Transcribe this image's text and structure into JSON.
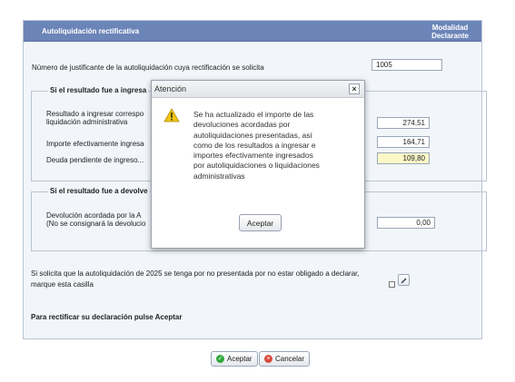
{
  "panel": {
    "title": "Autoliquidación rectificativa",
    "modality_line1": "Modalidad",
    "modality_line2": "Declarante"
  },
  "justificante": {
    "label": "Número de justificante de la autoliquidación cuya rectificación se solicita",
    "value": "1005"
  },
  "section_ingresar": {
    "legend": "Si el resultado fue a ingresa",
    "row1_label_line1": "Resultado a ingresar correspo",
    "row1_label_line2": "liquidación administrativa",
    "row1_value": "274,51",
    "row2_label": "Importe efectivamente ingresa",
    "row2_value": "164,71",
    "row3_label": "Deuda pendiente de ingreso...",
    "row3_value": "109,80"
  },
  "section_devolver": {
    "legend": "Si el resultado fue a devolve",
    "row1_label_line1": "Devolución acordada por la A",
    "row1_label_line2": "(No se consignará la devolucio",
    "row1_value": "0,00"
  },
  "no_presentada": {
    "line1": "Si solicita que la autoliquidación de 2025 se tenga por no presentada por no estar obligado a declarar,",
    "line2": "marque esta casilla"
  },
  "instruction": "Para rectificar su declaración pulse Aceptar",
  "buttons": {
    "accept": "Aceptar",
    "cancel": "Cancelar"
  },
  "dialog": {
    "title": "Atención",
    "message_lines": [
      "Se ha actualizado el importe de las",
      "devoluciones acordadas por",
      "autoliquidaciones presentadas, así",
      "como de los resultados a ingresar e",
      "importes efectivamente ingresados",
      "por autoliquidaciones o liquidaciones",
      "administrativas"
    ],
    "accept": "Aceptar",
    "close_glyph": "×"
  },
  "colors": {
    "header": "#6c85b8",
    "panel_bg": "#f2f5fa",
    "highlight_field": "#fcf8c8",
    "warning": "#f0c419"
  }
}
